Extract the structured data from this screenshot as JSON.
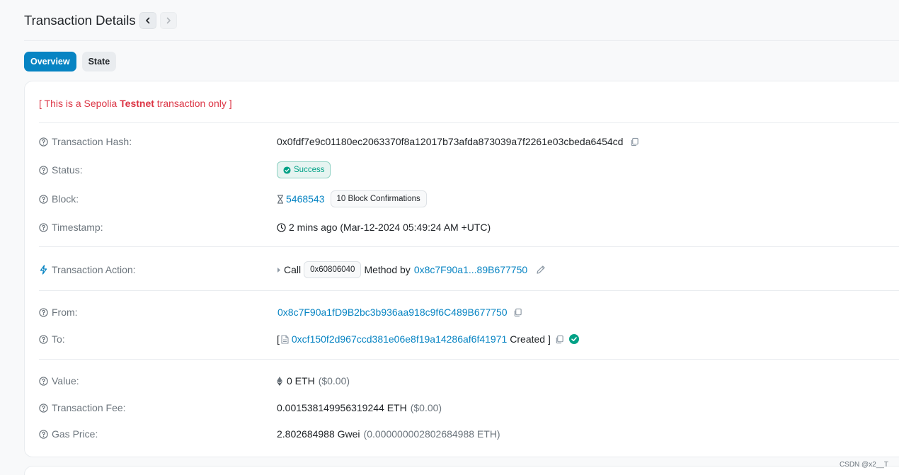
{
  "header": {
    "title": "Transaction Details"
  },
  "tabs": [
    {
      "label": "Overview"
    },
    {
      "label": "State"
    }
  ],
  "testnet_notice": {
    "prefix": "[ This is a Sepolia ",
    "bold": "Testnet",
    "suffix": " transaction only ]"
  },
  "rows": {
    "hash": {
      "label": "Transaction Hash:",
      "value": "0x0fdf7e9c01180ec2063370f8a12017b73afda873039a7f2261e03cbeda6454cd"
    },
    "status": {
      "label": "Status:",
      "value": "Success"
    },
    "block": {
      "label": "Block:",
      "number": "5468543",
      "confirmations": "10 Block Confirmations"
    },
    "timestamp": {
      "label": "Timestamp:",
      "value": "2 mins ago (Mar-12-2024 05:49:24 AM +UTC)"
    },
    "action": {
      "label": "Transaction Action:",
      "call": "Call",
      "method_id": "0x60806040",
      "method_by": "Method by",
      "address": "0x8c7F90a1...89B677750"
    },
    "from": {
      "label": "From:",
      "address": "0x8c7F90a1fD9B2bc3b936aa918c9f6C489B677750"
    },
    "to": {
      "label": "To:",
      "open": "[",
      "address": "0xcf150f2d967ccd381e06e8f19a14286af6f41971",
      "created": "Created ]"
    },
    "value": {
      "label": "Value:",
      "amount": "0 ETH",
      "usd": "($0.00)"
    },
    "fee": {
      "label": "Transaction Fee:",
      "amount": "0.001538149956319244 ETH",
      "usd": "($0.00)"
    },
    "gas": {
      "label": "Gas Price:",
      "amount": "2.802684988 Gwei",
      "eth": "(0.000000002802684988 ETH)"
    }
  },
  "watermark": "CSDN @x2__T",
  "colors": {
    "link": "#0784c3",
    "success": "#00a186",
    "danger": "#dc3545",
    "accent": "#0784c3"
  }
}
